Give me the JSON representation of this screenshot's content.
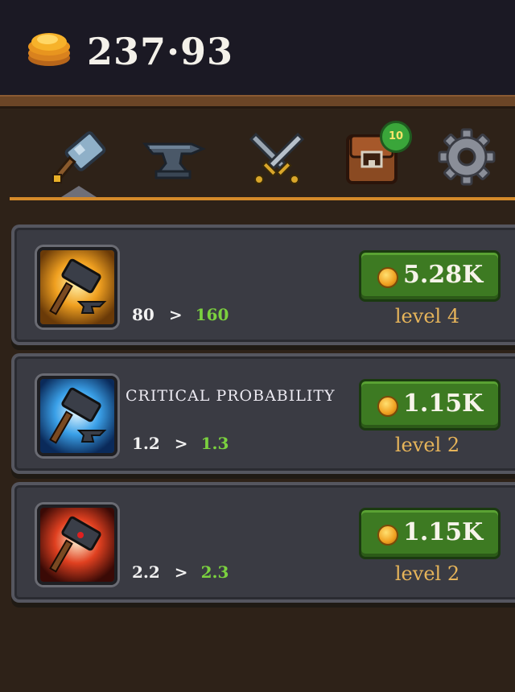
{
  "header": {
    "balance": "237·93",
    "currency_icon": "gold-coin-stack-icon"
  },
  "tabs": [
    {
      "icon": "hammer-icon",
      "active": true
    },
    {
      "icon": "anvil-icon",
      "active": false
    },
    {
      "icon": "crossed-swords-icon",
      "active": false
    },
    {
      "icon": "backpack-icon",
      "active": false,
      "badge": "10"
    },
    {
      "icon": "gear-icon",
      "active": false
    }
  ],
  "upgrades": [
    {
      "title": "",
      "current": "80",
      "arrow": ">",
      "next": "160",
      "price": "5.28K",
      "level_label": "level",
      "level": "4",
      "icon_color": "#f0a020"
    },
    {
      "title": "CRITICAL PROBABILITY",
      "current": "1.2",
      "arrow": ">",
      "next": "1.3",
      "price": "1.15K",
      "level_label": "level",
      "level": "2",
      "icon_color": "#3aa0e8"
    },
    {
      "title": "",
      "current": "2.2",
      "arrow": ">",
      "next": "2.3",
      "price": "1.15K",
      "level_label": "level",
      "level": "2",
      "icon_color": "#e04020"
    }
  ],
  "colors": {
    "accent_underline": "#d58a2a",
    "buy_button": "#3d7a22",
    "next_value": "#7bd13f",
    "level_text": "#e6b45a"
  }
}
